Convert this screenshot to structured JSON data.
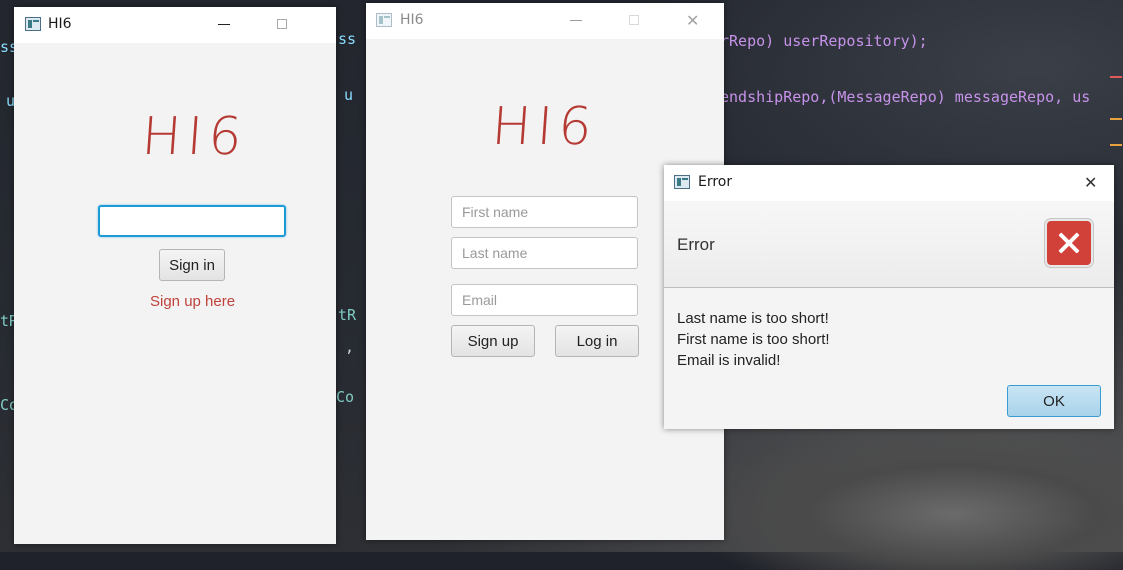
{
  "background": {
    "code_fragments": [
      "ss",
      "u",
      "tR",
      "Co",
      "ss",
      "u",
      "tR",
      ",",
      "Co",
      "rRepo) userRepository);",
      "endshipRepo,(MessageRepo) messageRepo, us"
    ]
  },
  "signin_window": {
    "title": "HI6",
    "logo": "HI6",
    "username_value": "",
    "signin_label": "Sign in",
    "signup_link": "Sign up here"
  },
  "signup_window": {
    "title": "HI6",
    "logo": "HI6",
    "first_name_placeholder": "First name",
    "last_name_placeholder": "Last name",
    "email_placeholder": "Email",
    "signup_label": "Sign up",
    "login_label": "Log in"
  },
  "error_dialog": {
    "title": "Error",
    "header": "Error",
    "messages": [
      "Last name is too short!",
      "First name is too short!",
      "Email is invalid!"
    ],
    "ok_label": "OK"
  },
  "colors": {
    "logo": "#b53a34",
    "link": "#c0423a",
    "focus": "#1e9ad6",
    "error_icon": "#d2403a"
  },
  "icons": [
    "app-icon",
    "minimize-icon",
    "maximize-icon",
    "close-icon",
    "error-icon"
  ]
}
